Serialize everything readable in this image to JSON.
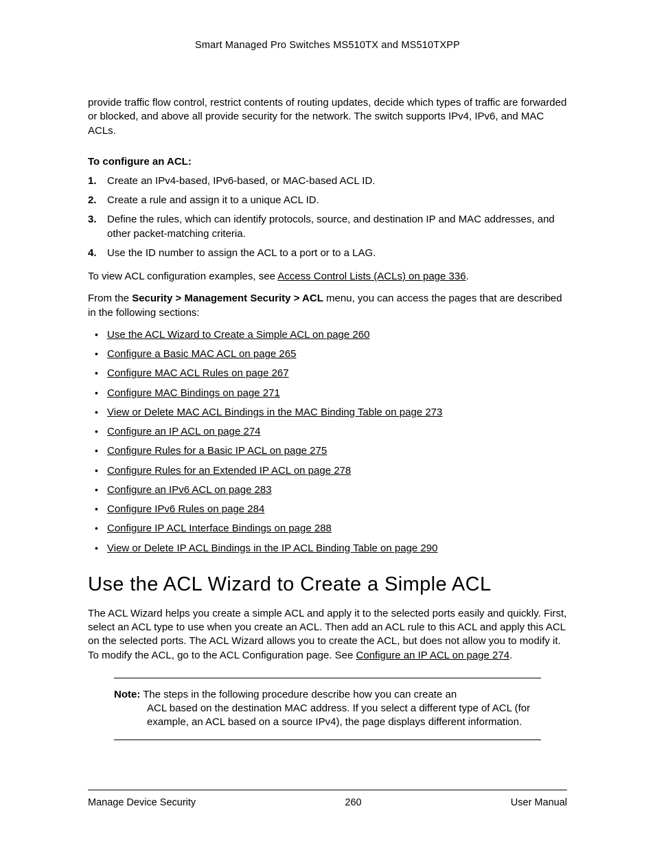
{
  "header": {
    "title": "Smart Managed Pro Switches MS510TX and MS510TXPP"
  },
  "intro": "provide traffic flow control, restrict contents of routing updates, decide which types of traffic are forwarded or blocked, and above all provide security for the network. The switch supports IPv4, IPv6, and MAC ACLs.",
  "configure_heading": "To configure an ACL:",
  "steps": [
    "Create an IPv4-based, IPv6-based, or MAC-based ACL ID.",
    "Create a rule and assign it to a unique ACL ID.",
    "Define the rules, which can identify protocols, source, and destination IP and MAC addresses, and other packet-matching criteria.",
    "Use the ID number to assign the ACL to a port or to a LAG."
  ],
  "view_examples_pre": "To view ACL configuration examples, see ",
  "view_examples_link": "Access Control Lists (ACLs) on page 336",
  "view_examples_post": ".",
  "from_menu_pre": "From the ",
  "from_menu_bold": "Security > Management Security > ACL",
  "from_menu_post": " menu, you can access the pages that are described in the following sections:",
  "bullet_links": [
    "Use the ACL Wizard to Create a Simple ACL on page 260",
    "Configure a Basic MAC ACL on page 265",
    "Configure MAC ACL Rules on page 267",
    "Configure MAC Bindings on page 271",
    "View or Delete MAC ACL Bindings in the MAC Binding Table on page 273",
    "Configure an IP ACL on page 274",
    "Configure Rules for a Basic IP ACL on page 275",
    "Configure Rules for an Extended IP ACL on page 278",
    "Configure an IPv6 ACL on page 283",
    "Configure IPv6 Rules on page 284",
    "Configure IP ACL Interface Bindings on page 288",
    "View or Delete IP ACL Bindings in the IP ACL Binding Table on page 290"
  ],
  "section_title": "Use the ACL Wizard to Create a Simple ACL",
  "section_body_pre": "The ACL Wizard helps you create a simple ACL and apply it to the selected ports easily and quickly. First, select an ACL type to use when you create an ACL. Then add an ACL rule to this ACL and apply this ACL on the selected ports. The ACL Wizard allows you to create the ACL, but does not allow you to modify it. To modify the ACL, go to the ACL Configuration page. See ",
  "section_body_link": "Configure an IP ACL on page 274",
  "section_body_post": ".",
  "note": {
    "label": "Note:",
    "line1": "The steps in the following procedure describe how you can create an",
    "cont": "ACL based on the destination MAC address. If you select a different type of ACL (for example, an ACL based on a source IPv4), the page displays different information."
  },
  "footer": {
    "left": "Manage Device Security",
    "center": "260",
    "right": "User Manual"
  }
}
